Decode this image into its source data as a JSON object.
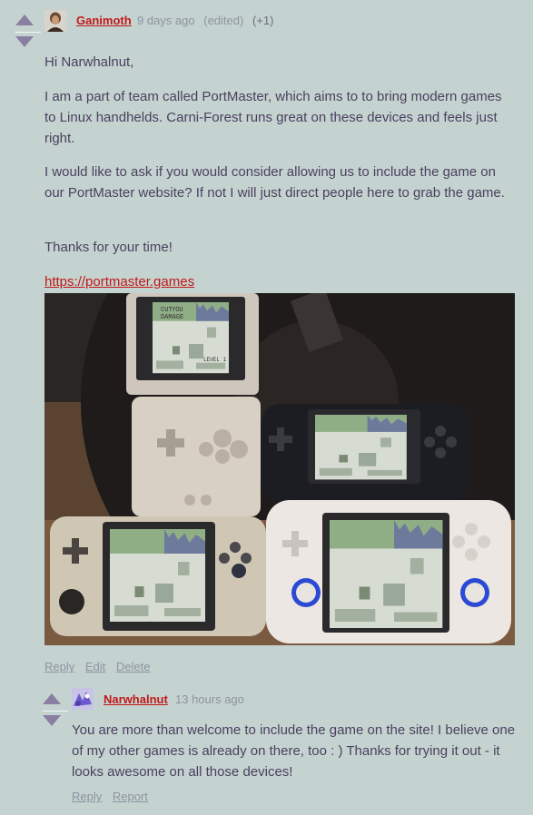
{
  "comment1": {
    "author": "Ganimoth",
    "time": "9 days ago",
    "edited": "(edited)",
    "score": "(+1)",
    "paragraphs": [
      "Hi Narwhalnut,",
      "I am a part of team called PortMaster, which aims to to bring modern games to Linux handhelds. Carni-Forest runs great on these devices and feels just right.",
      "I would like to ask if you would consider allowing us to include the game on our PortMaster website? If not I will just direct people here to grab the game.",
      "Thanks for your time!"
    ],
    "link": "https://portmaster.games",
    "actions": [
      "Reply",
      "Edit",
      "Delete"
    ]
  },
  "photo": {
    "screen_text": [
      "CUT",
      "YOU",
      "DAMAGE",
      "LEVEL 1"
    ]
  },
  "comment2": {
    "author": "Narwhalnut",
    "time": "13 hours ago",
    "text": "You are more than welcome to include the game on the site! I believe one of my other games is already on there, too : ) Thanks for trying it out - it looks awesome on all those devices!",
    "actions": [
      "Reply",
      "Report"
    ]
  },
  "colors": {
    "background": "#c5d3d0",
    "username": "#c01818",
    "vote_arrow": "#8a7fa3",
    "text": "#4a4060"
  }
}
